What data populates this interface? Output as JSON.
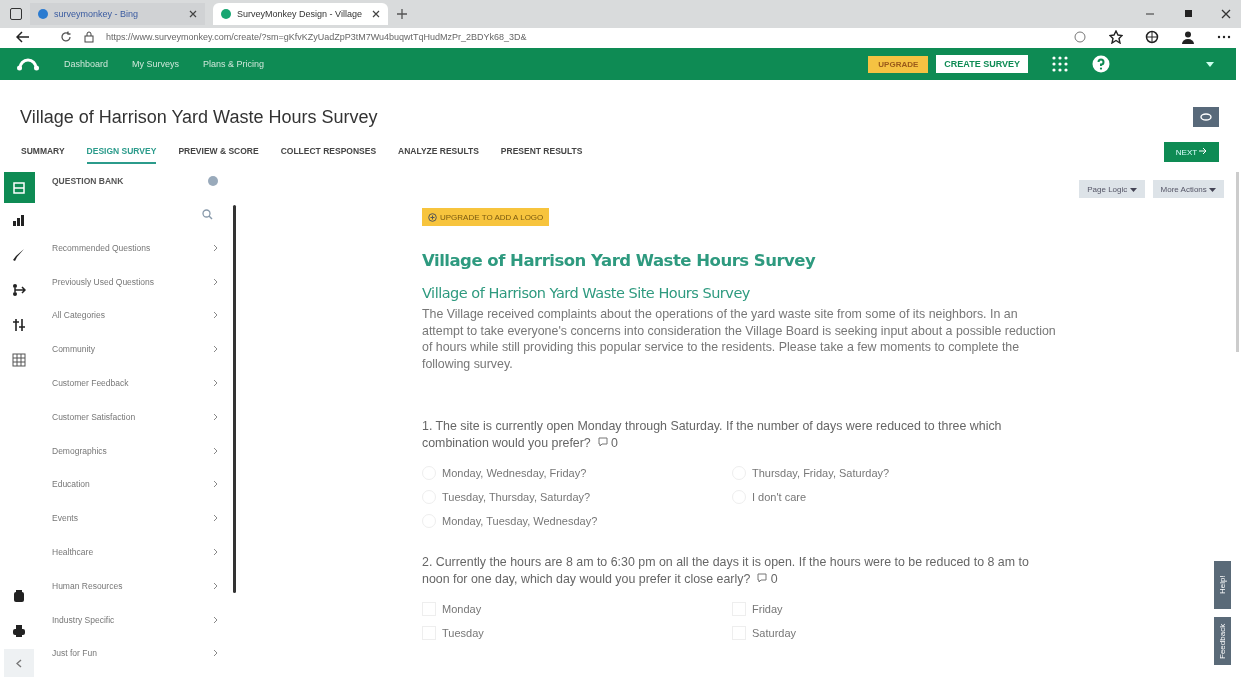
{
  "browser": {
    "tabs": [
      {
        "label": "surveymonkey - Bing",
        "selected": false
      },
      {
        "label": "SurveyMonkey Design - Village",
        "selected": true
      }
    ],
    "url": "https://www.surveymonkey.com/create/?sm=gKfvKZyUadZpP3tM7Wu4buqwtTqHudMzPr_2BDYk68_3D&"
  },
  "nav": {
    "links": [
      "Dashboard",
      "My Surveys",
      "Plans & Pricing"
    ],
    "upgrade": "UPGRADE",
    "create": "CREATE SURVEY"
  },
  "survey_title": "Village of Harrison Yard Waste Hours Survey",
  "tabs": [
    {
      "label": "SUMMARY",
      "selected": false
    },
    {
      "label": "DESIGN SURVEY",
      "selected": true
    },
    {
      "label": "PREVIEW & SCORE",
      "selected": false
    },
    {
      "label": "COLLECT RESPONSES",
      "selected": false
    },
    {
      "label": "ANALYZE RESULTS",
      "selected": false
    },
    {
      "label": "PRESENT RESULTS",
      "selected": false
    }
  ],
  "next": "NEXT",
  "question_bank": {
    "title": "QUESTION BANK",
    "items": [
      "Recommended Questions",
      "Previously Used Questions",
      "All Categories",
      "Community",
      "Customer Feedback",
      "Customer Satisfaction",
      "Demographics",
      "Education",
      "Events",
      "Healthcare",
      "Human Resources",
      "Industry Specific",
      "Just for Fun"
    ]
  },
  "toolbar": [
    "Page Logic",
    "More Actions"
  ],
  "logo_button": "UPGRADE TO ADD A LOGO",
  "page_title": "Village of Harrison Yard Waste Hours Survey",
  "survey": {
    "subtitle": "Village of Harrison Yard Waste Site Hours Survey",
    "description": "The Village received complaints about the operations of the yard waste site from some of its neighbors.  In an attempt to take everyone's concerns into consideration the Village Board is seeking input about a possible reduction of hours while still providing this popular service to the residents.  Please take a few moments to complete the following survey.",
    "questions": [
      {
        "text": "1. The site is currently open Monday through Saturday.  If the number of days were reduced to three which combination would you prefer?",
        "comments": "0",
        "kind": "radio",
        "options": [
          "Monday, Wednesday, Friday?",
          "Thursday, Friday, Saturday?",
          "Tuesday, Thursday, Saturday?",
          "I don't care",
          "Monday, Tuesday, Wednesday?"
        ]
      },
      {
        "text": "2. Currently the hours are 8 am to 6:30 pm on all the days it is open.  If the hours were to be reduced to 8 am to noon for one day, which day would you prefer it close early?",
        "comments": "0",
        "kind": "checkbox",
        "options": [
          "Monday",
          "Friday",
          "Tuesday",
          "Saturday"
        ]
      }
    ]
  },
  "side_tabs": [
    "Help!",
    "Feedback"
  ]
}
